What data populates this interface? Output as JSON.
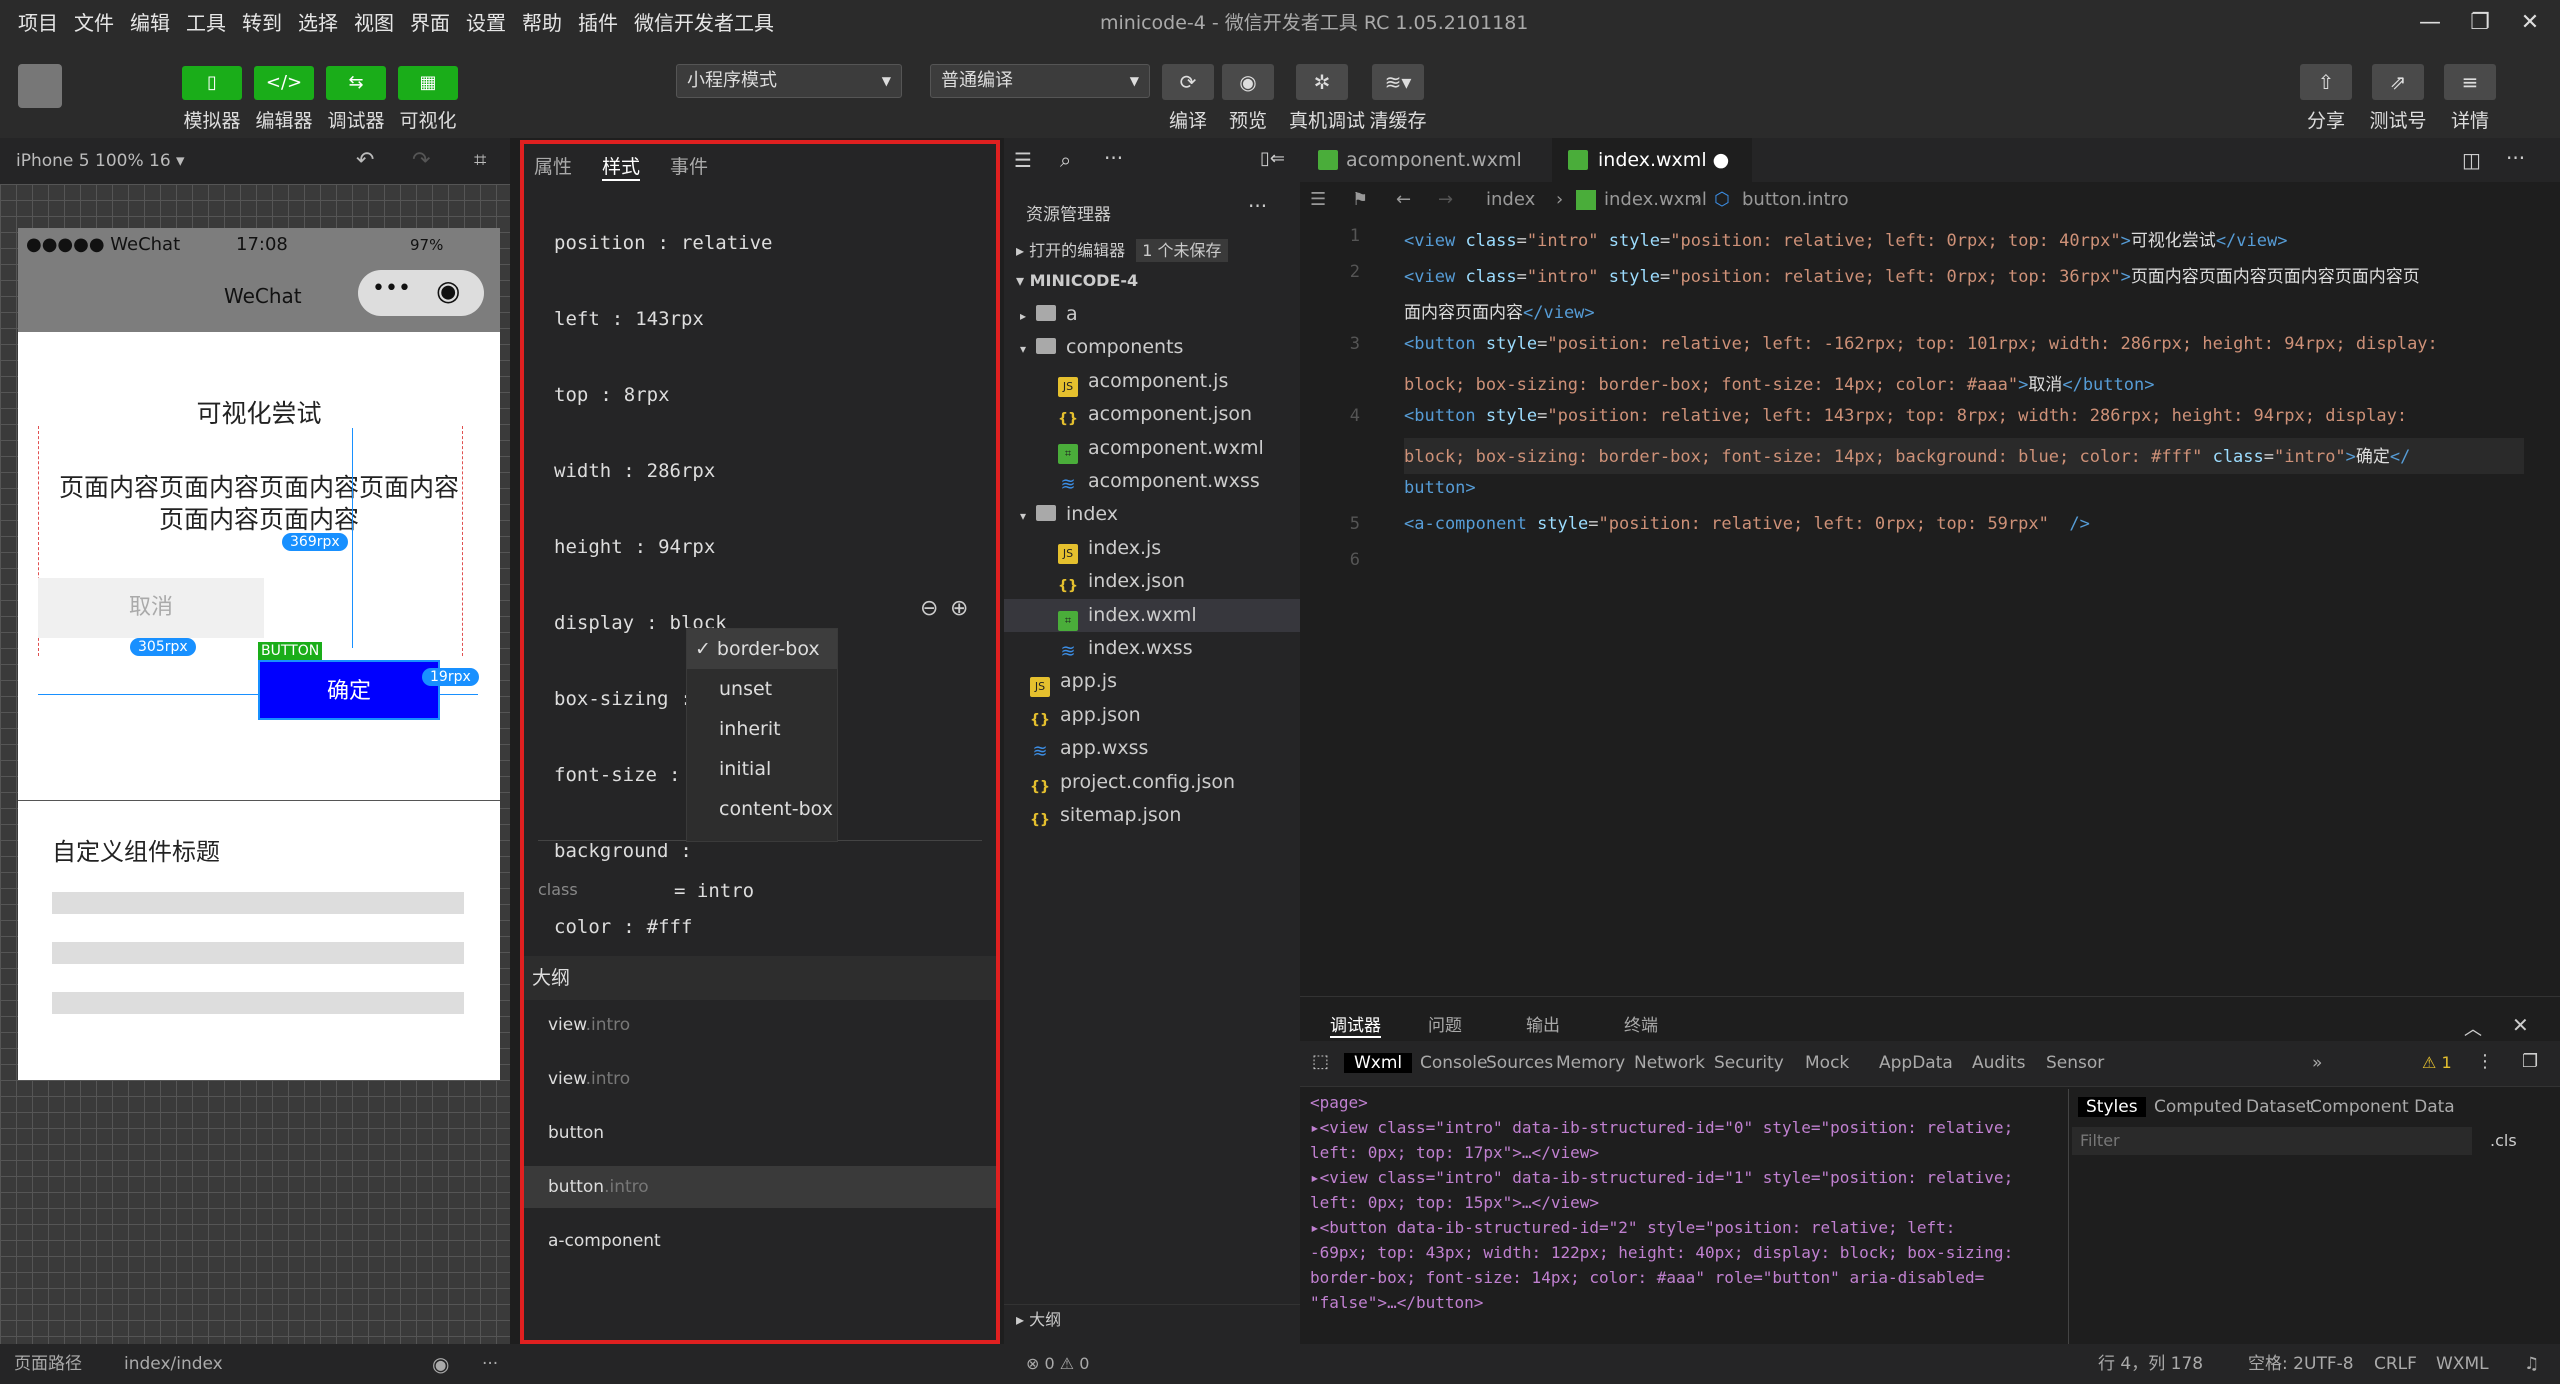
{
  "menubar": {
    "items": [
      "项目",
      "文件",
      "编辑",
      "工具",
      "转到",
      "选择",
      "视图",
      "界面",
      "设置",
      "帮助",
      "插件",
      "微信开发者工具"
    ],
    "title": "minicode-4 - 微信开发者工具 RC 1.05.2101181"
  },
  "toolbar": {
    "left_buttons": [
      "模拟器",
      "编辑器",
      "调试器",
      "可视化"
    ],
    "mode_select": "小程序模式",
    "compile_select": "普通编译",
    "right_mid": [
      "编译",
      "预览",
      "真机调试",
      "清缓存"
    ],
    "right": [
      "分享",
      "测试号",
      "详情"
    ]
  },
  "sim": {
    "device": "iPhone 5 100% 16",
    "status_left": "●●●●● WeChat",
    "time": "17:08",
    "battery": "97%",
    "nav_title": "WeChat",
    "heading": "可视化尝试",
    "para1": "页面内容页面内容页面内容页面内容",
    "para2": "页面内容页面内容",
    "b1": "369rpx",
    "cancel": "取消",
    "b2": "305rpx",
    "button_tag": "BUTTON",
    "confirm": "确定",
    "b3": "19rpx",
    "comp_title": "自定义组件标题",
    "footer_path": "页面路径",
    "footer_page": "index/index"
  },
  "props": {
    "tabs": [
      "属性",
      "样式",
      "事件"
    ],
    "rows": [
      {
        "k": "position",
        "v": "relative"
      },
      {
        "k": "left",
        "v": "143rpx"
      },
      {
        "k": "top",
        "v": "8rpx"
      },
      {
        "k": "width",
        "v": "286rpx"
      },
      {
        "k": "height",
        "v": "94rpx"
      },
      {
        "k": "display",
        "v": "block"
      },
      {
        "k": "box-sizing",
        "v": "border-box"
      },
      {
        "k": "font-size",
        "v": ""
      },
      {
        "k": "background",
        "v": ""
      },
      {
        "k": "color",
        "v": "#fff"
      }
    ],
    "dropdown": [
      "border-box",
      "unset",
      "inherit",
      "initial",
      "content-box"
    ],
    "class_label": "class",
    "class_value": "intro",
    "outline_title": "大纲",
    "outline": [
      {
        "n": "view",
        "c": ".intro"
      },
      {
        "n": "view",
        "c": ".intro"
      },
      {
        "n": "button",
        "c": ""
      },
      {
        "n": "button",
        "c": ".intro"
      },
      {
        "n": "a-component",
        "c": ""
      }
    ]
  },
  "explorer": {
    "title": "资源管理器",
    "open_editors": "打开的编辑器",
    "unsaved": "1 个未保存",
    "project": "MINICODE-4",
    "outline": "大纲",
    "problems": "0 ⚠ 0",
    "items": [
      {
        "t": "a",
        "d": 1,
        "i": "folder"
      },
      {
        "t": "components",
        "d": 1,
        "i": "folder"
      },
      {
        "t": "acomponent.js",
        "d": 2,
        "i": "js"
      },
      {
        "t": "acomponent.json",
        "d": 2,
        "i": "json"
      },
      {
        "t": "acomponent.wxml",
        "d": 2,
        "i": "wxml"
      },
      {
        "t": "acomponent.wxss",
        "d": 2,
        "i": "wxss"
      },
      {
        "t": "index",
        "d": 1,
        "i": "folder"
      },
      {
        "t": "index.js",
        "d": 2,
        "i": "js"
      },
      {
        "t": "index.json",
        "d": 2,
        "i": "json"
      },
      {
        "t": "index.wxml",
        "d": 2,
        "i": "wxml"
      },
      {
        "t": "index.wxss",
        "d": 2,
        "i": "wxss"
      },
      {
        "t": "app.js",
        "d": 1,
        "i": "js"
      },
      {
        "t": "app.json",
        "d": 1,
        "i": "json"
      },
      {
        "t": "app.wxss",
        "d": 1,
        "i": "wxss"
      },
      {
        "t": "project.config.json",
        "d": 1,
        "i": "json"
      },
      {
        "t": "sitemap.json",
        "d": 1,
        "i": "json"
      }
    ]
  },
  "editor": {
    "tabs": [
      "acomponent.wxml",
      "index.wxml"
    ],
    "breadcrumb": [
      "index",
      "index.wxml",
      "button.intro"
    ]
  },
  "devtools": {
    "top_tabs": [
      "调试器",
      "问题",
      "输出",
      "终端"
    ],
    "tabs": [
      "Wxml",
      "Console",
      "Sources",
      "Memory",
      "Network",
      "Security",
      "Mock",
      "AppData",
      "Audits",
      "Sensor"
    ],
    "warn": "1",
    "style_tabs": [
      "Styles",
      "Computed",
      "Dataset",
      "Component Data"
    ],
    "filter": "Filter",
    "cls": ".cls",
    "lines": [
      "<page>",
      "▸<view class=\"intro\" data-ib-structured-id=\"0\" style=\"position: relative;",
      "left: 0px; top: 17px\">…</view>",
      "▸<view class=\"intro\" data-ib-structured-id=\"1\" style=\"position: relative;",
      "left: 0px; top: 15px\">…</view>",
      "▸<button data-ib-structured-id=\"2\" style=\"position: relative; left:",
      "-69px; top: 43px; width: 122px; height: 40px; display: block; box-sizing:",
      "border-box; font-size: 14px; color: #aaa\" role=\"button\" aria-disabled=",
      "\"false\">…</button>"
    ]
  },
  "status": {
    "pos": "行 4，列 178",
    "spaces": "空格: 2",
    "enc": "UTF-8",
    "eol": "CRLF",
    "lang": "WXML"
  }
}
